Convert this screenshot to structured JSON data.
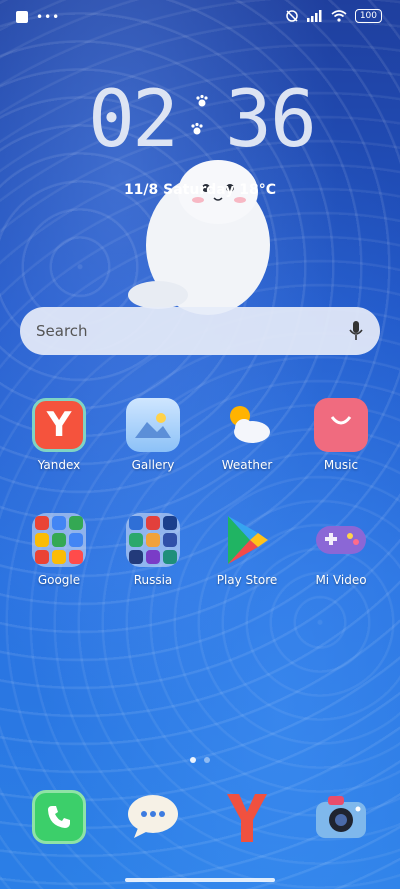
{
  "status_bar": {
    "battery": "100"
  },
  "clock": {
    "h1": "0",
    "h2": "2",
    "m1": "3",
    "m2": "6"
  },
  "date_line": "11/8  Saturday  18°C",
  "search": {
    "placeholder": "Search"
  },
  "apps": [
    {
      "label": "Yandex"
    },
    {
      "label": "Gallery"
    },
    {
      "label": "Weather"
    },
    {
      "label": "Music"
    },
    {
      "label": "Google"
    },
    {
      "label": "Russia"
    },
    {
      "label": "Play Store"
    },
    {
      "label": "Mi Video"
    }
  ],
  "yandex_glyph": "Y",
  "dock": [
    {
      "icon": "phone-icon"
    },
    {
      "icon": "messages-icon"
    },
    {
      "icon": "yandex-browser-icon"
    },
    {
      "icon": "camera-icon"
    }
  ],
  "page_indicator": {
    "pages": 2,
    "current": 1
  },
  "colors": {
    "search_bg": "#e6ecf8",
    "yandex_red": "#f5533d",
    "music_pink": "#f06b7f",
    "phone_green": "#3ccf6a"
  }
}
